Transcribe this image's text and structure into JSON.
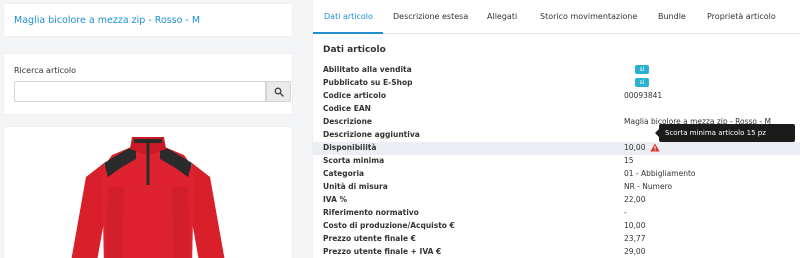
{
  "product": {
    "title": "Maglia bicolore a mezza zip - Rosso - M"
  },
  "search": {
    "label": "Ricerca articolo",
    "value": "",
    "placeholder": ""
  },
  "tabs": [
    {
      "label": "Dati articolo",
      "active": true
    },
    {
      "label": "Descrizione estesa"
    },
    {
      "label": "Allegati"
    },
    {
      "label": "Storico movimentazione"
    },
    {
      "label": "Bundle"
    },
    {
      "label": "Proprietà articolo"
    }
  ],
  "section": {
    "title": "Dati articolo"
  },
  "badges": {
    "si": "si"
  },
  "rows": [
    {
      "label": "Abilitato alla vendita",
      "value": "si",
      "badge": true
    },
    {
      "label": "Pubblicato su E-Shop",
      "value": "si",
      "badge": true
    },
    {
      "label": "Codice articolo",
      "value": "00093841"
    },
    {
      "label": "Codice EAN",
      "value": ""
    },
    {
      "label": "Descrizione",
      "value": "Maglia bicolore a mezza zip - Rosso - M"
    },
    {
      "label": "Descrizione aggiuntiva",
      "value": ""
    },
    {
      "label": "Disponibilità",
      "value": "10,00",
      "warning": true,
      "highlighted": true
    },
    {
      "label": "Scorta minima",
      "value": "15"
    },
    {
      "label": "Categoria",
      "value": "01 - Abbigliamento"
    },
    {
      "label": "Unità di misura",
      "value": "NR - Numero"
    },
    {
      "label": "IVA %",
      "value": "22,00"
    },
    {
      "label": "Riferimento normativo",
      "value": "-"
    },
    {
      "label": "Costo di produzione/Acquisto €",
      "value": "10,00"
    },
    {
      "label": "Prezzo utente finale €",
      "value": "23,77"
    },
    {
      "label": "Prezzo utente finale + IVA €",
      "value": "29,00"
    }
  ],
  "tooltip": {
    "text": "Scorta minima articolo 15 pz"
  },
  "icons": {
    "search": "search-icon",
    "warning": "warning-triangle-icon"
  },
  "colors": {
    "accent": "#1f8fd1",
    "badge": "#29b1cf",
    "warning": "#d9312b",
    "product": "#d91f2a"
  }
}
